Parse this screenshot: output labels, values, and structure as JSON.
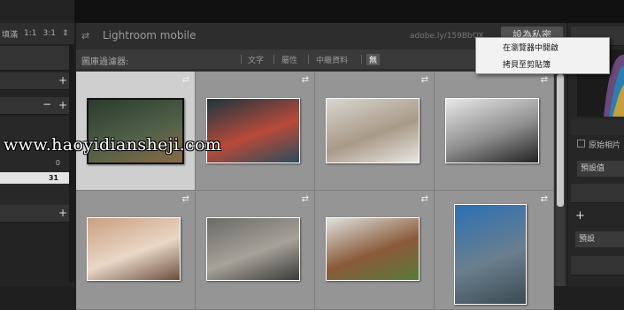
{
  "left_panel": {
    "zoom_options": [
      "填滿",
      "1:1",
      "3:1"
    ],
    "zoom_chevron": "⇕",
    "value_zero": "0",
    "value_selected": "31"
  },
  "publisher": {
    "arrow": "⇄",
    "title": "Lightroom mobile",
    "url": "adobe.ly/159BbOX",
    "share_button": "設為私密"
  },
  "filter_bar": {
    "label": "圖庫過濾器:",
    "tabs": [
      "文字",
      "屬性",
      "中繼資料",
      "無"
    ],
    "active_tab": "無"
  },
  "context_menu": {
    "items": [
      "在瀏覽器中開啟",
      "拷貝至剪貼簿"
    ]
  },
  "grid": {
    "rows": 2,
    "columns": 4,
    "selected_index": 0,
    "photos": [
      {
        "name": "forest-photo",
        "colors": [
          "#2c3a2e",
          "#506048",
          "#8a6a44"
        ]
      },
      {
        "name": "camera-woman-photo",
        "colors": [
          "#1c3540",
          "#b84a3a",
          "#2a4d5a"
        ]
      },
      {
        "name": "city-street-photo",
        "colors": [
          "#d8d6d0",
          "#a89a88",
          "#e8e6e2"
        ]
      },
      {
        "name": "subway-woman-photo",
        "colors": [
          "#e8e8e8",
          "#8e8e8e",
          "#222"
        ]
      },
      {
        "name": "phone-beach-photo",
        "colors": [
          "#c9a07e",
          "#e9d7c7",
          "#6b4e3c"
        ]
      },
      {
        "name": "city-aerial-photo",
        "colors": [
          "#6b6a66",
          "#a6a29a",
          "#3a3a38"
        ]
      },
      {
        "name": "field-photo",
        "colors": [
          "#dfe2de",
          "#8a5a3a",
          "#5a7a3a"
        ]
      },
      {
        "name": "mountain-photo",
        "colors": [
          "#2d6fb4",
          "#6a7f8e",
          "#3b4a52"
        ]
      }
    ]
  },
  "right_panel": {
    "original_label": "原始相片",
    "preset_label": "預設值",
    "preset2_label": "預設",
    "plus": "+"
  },
  "watermark": "www.haoyidiansheji.com",
  "colors": {
    "background": "#1f1f1f",
    "grid_bg": "#959595",
    "selected_cell": "#cfcfcf",
    "menu_bg": "#f2f2f2"
  }
}
